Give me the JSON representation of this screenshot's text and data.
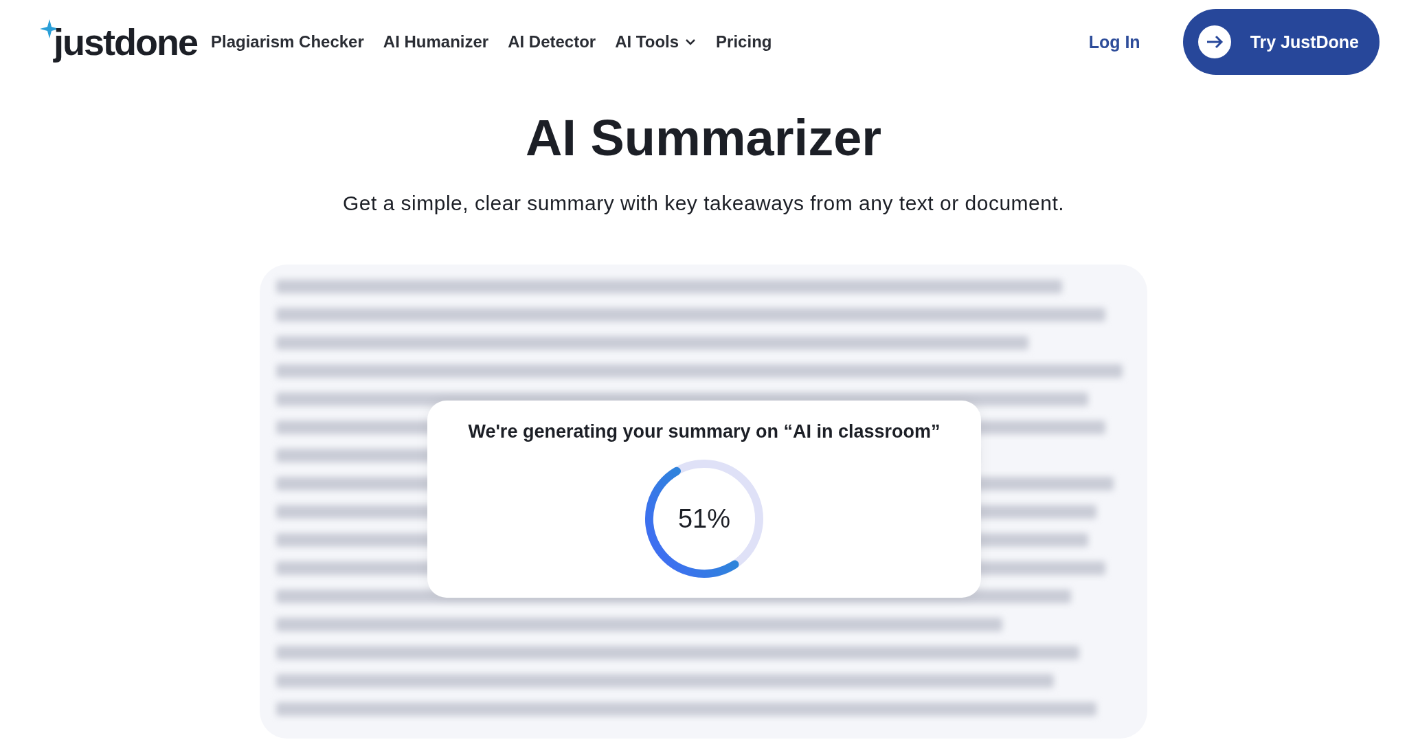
{
  "header": {
    "logo": "justdone",
    "nav": [
      {
        "label": "Plagiarism Checker",
        "kind": "link"
      },
      {
        "label": "AI Humanizer",
        "kind": "link"
      },
      {
        "label": "AI Detector",
        "kind": "link"
      },
      {
        "label": "AI Tools",
        "kind": "dropdown"
      },
      {
        "label": "Pricing",
        "kind": "link"
      }
    ],
    "login": "Log In",
    "cta": "Try JustDone"
  },
  "title": "AI Summarizer",
  "subtitle": "Get a simple, clear summary with key takeaways from any text or document.",
  "progress": {
    "message": "We're generating your summary on “AI in classroom”",
    "level": 0.51,
    "reading": "51%"
  }
}
